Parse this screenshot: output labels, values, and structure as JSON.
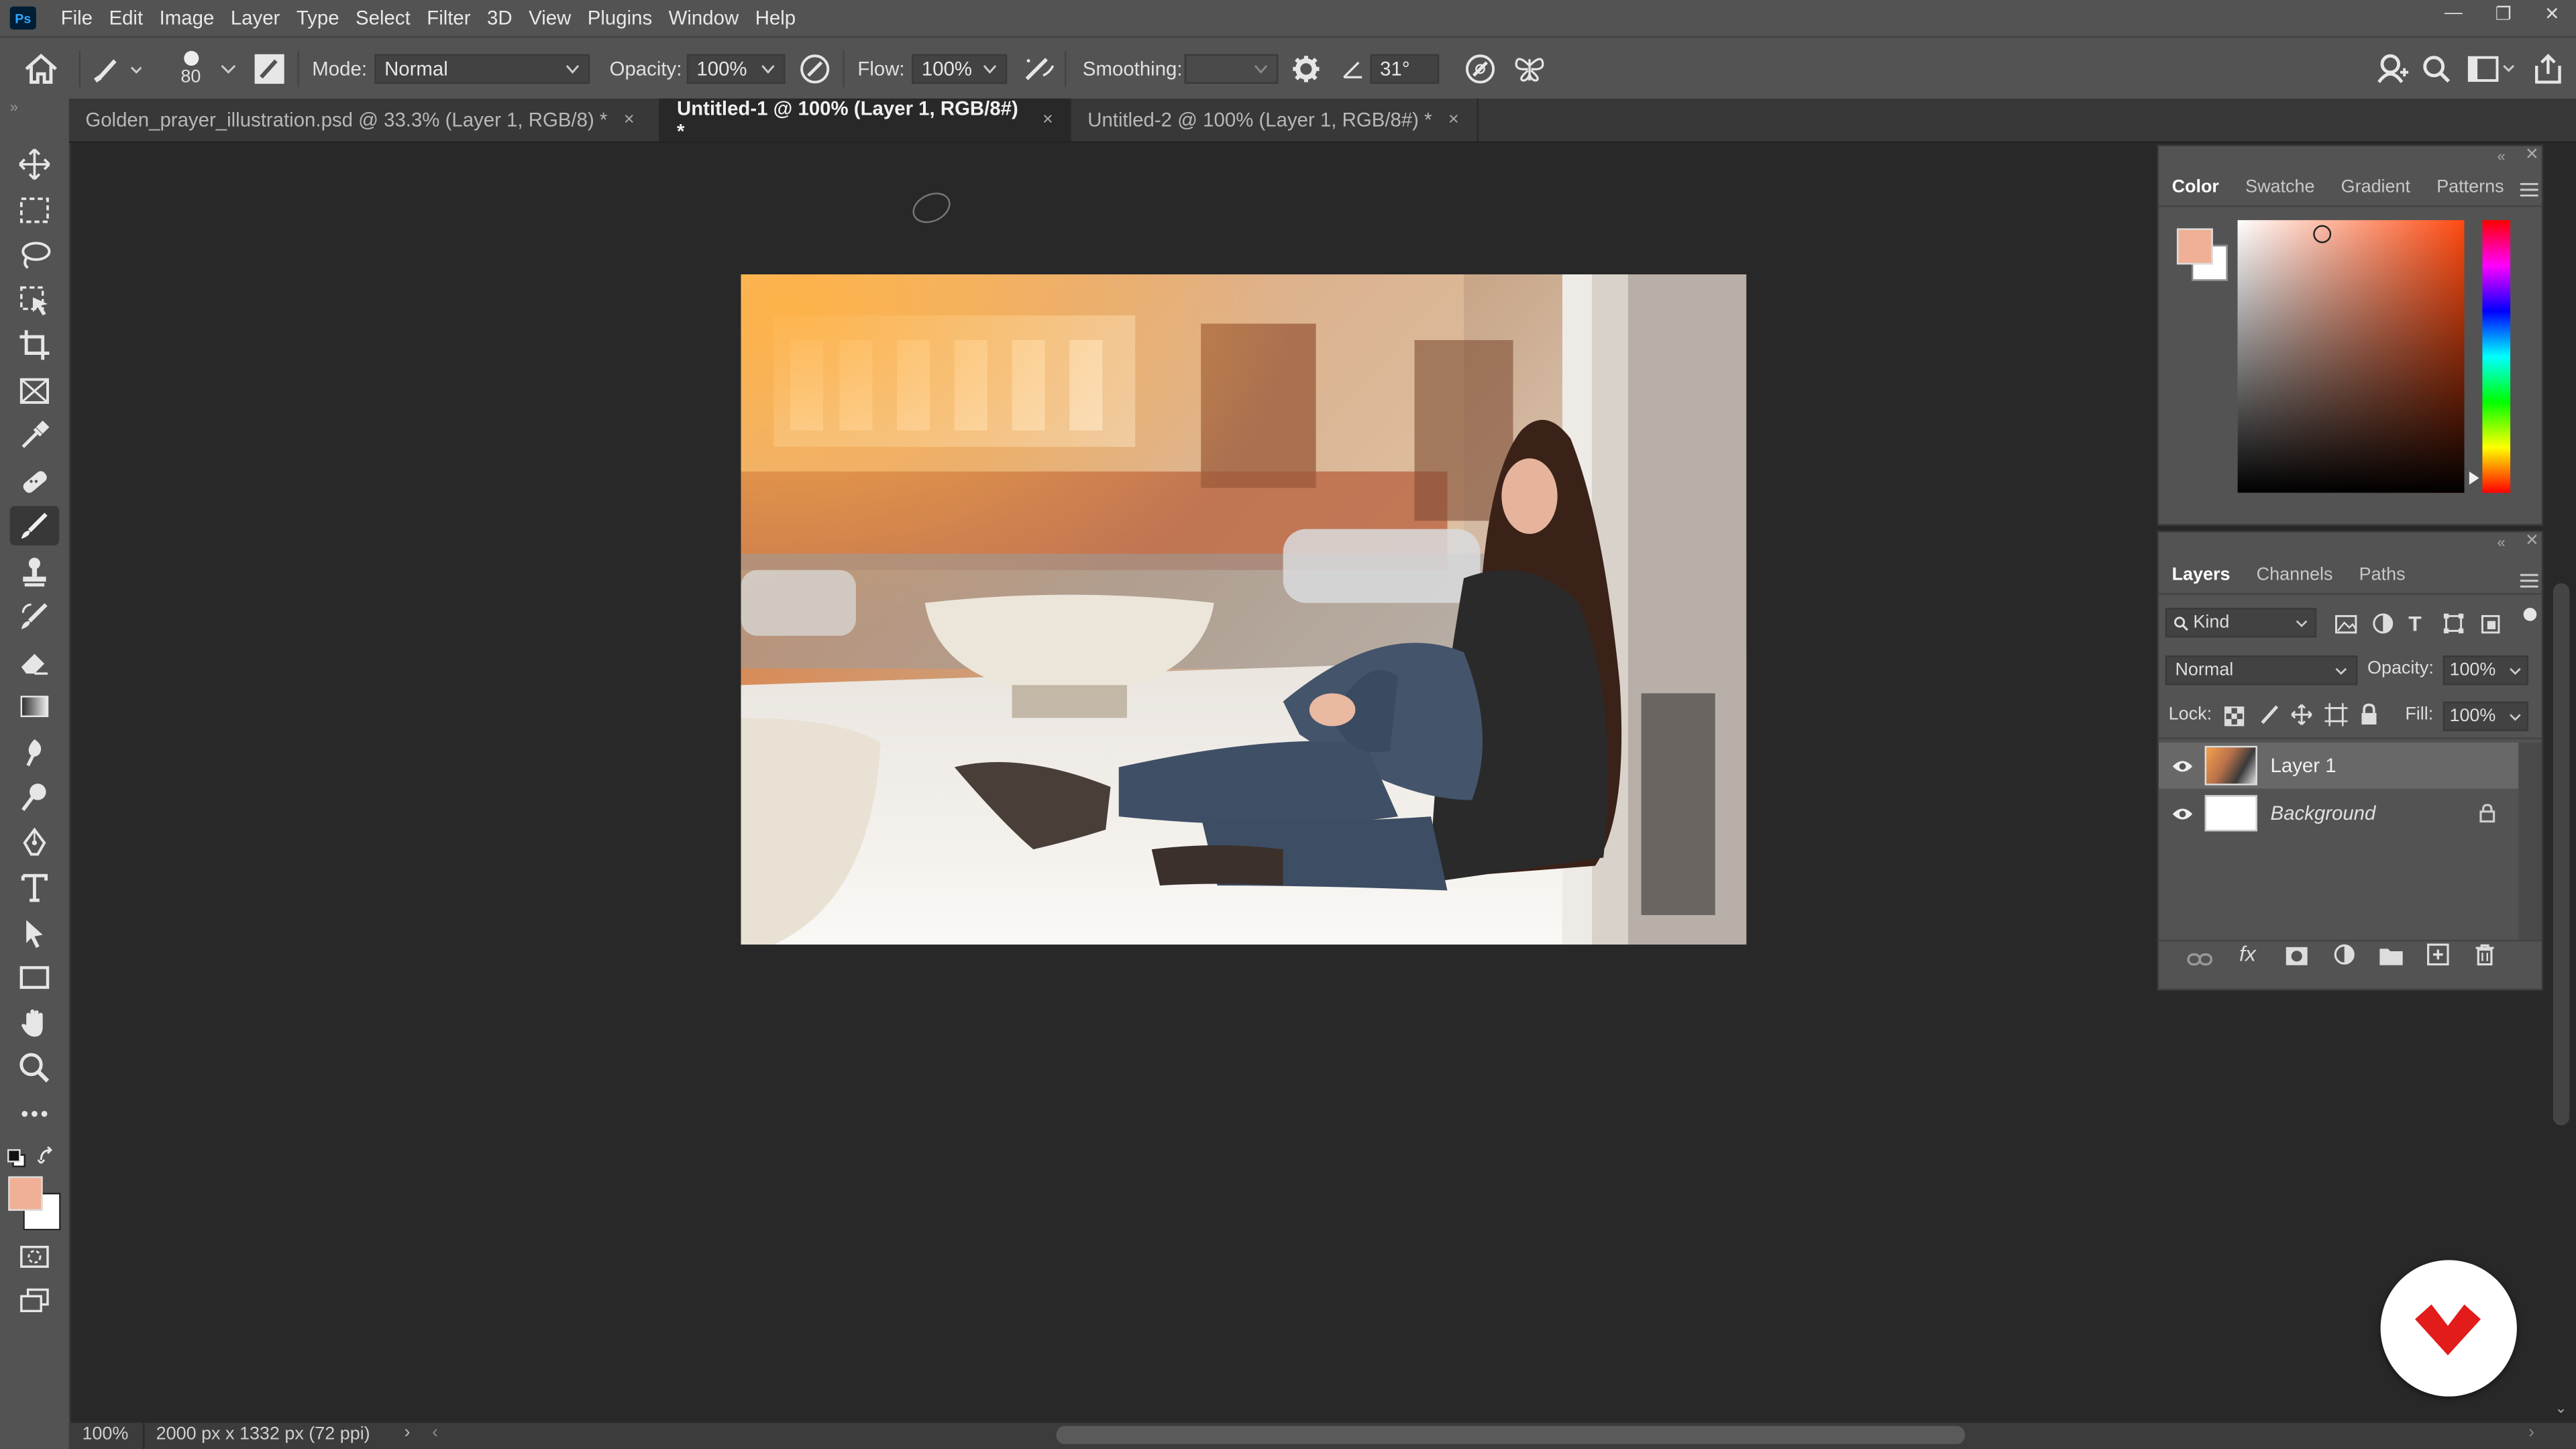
{
  "menu": {
    "app_icon_text": "Ps",
    "items": [
      "File",
      "Edit",
      "Image",
      "Layer",
      "Type",
      "Select",
      "Filter",
      "3D",
      "View",
      "Plugins",
      "Window",
      "Help"
    ]
  },
  "options": {
    "brush_size": "80",
    "mode_label": "Mode:",
    "mode_value": "Normal",
    "opacity_label": "Opacity:",
    "opacity_value": "100%",
    "flow_label": "Flow:",
    "flow_value": "100%",
    "smoothing_label": "Smoothing:",
    "smoothing_value": "",
    "angle_value": "31°"
  },
  "tabs": [
    {
      "label": "Golden_prayer_illustration.psd @ 33.3% (Layer 1, RGB/8) *",
      "close": "×",
      "active": false
    },
    {
      "label": "Untitled-1 @ 100% (Layer 1, RGB/8#) *",
      "close": "×",
      "active": true
    },
    {
      "label": "Untitled-2 @ 100% (Layer 1, RGB/8#) *",
      "close": "×",
      "active": false
    }
  ],
  "color_panel": {
    "tabs": [
      "Color",
      "Swatche",
      "Gradient",
      "Patterns"
    ],
    "foreground_color": "#f0b095",
    "background_color": "#ffffff"
  },
  "layers_panel": {
    "tabs": [
      "Layers",
      "Channels",
      "Paths"
    ],
    "filter_kind": "Kind",
    "blend_mode": "Normal",
    "opacity_label": "Opacity:",
    "opacity_value": "100%",
    "lock_label": "Lock:",
    "fill_label": "Fill:",
    "fill_value": "100%",
    "layers": [
      {
        "name": "Layer 1",
        "visible": true,
        "selected": true,
        "locked": false
      },
      {
        "name": "Background",
        "visible": true,
        "selected": false,
        "locked": true
      }
    ],
    "fx_label": "fx"
  },
  "status": {
    "zoom": "100%",
    "doc_info": "2000 px x 1332 px (72 ppi)"
  },
  "toolbar": {
    "tools": [
      "move-tool",
      "marquee-tool",
      "lasso-tool",
      "object-select-tool",
      "crop-tool",
      "frame-tool",
      "eyedropper-tool",
      "healing-tool",
      "brush-tool",
      "stamp-tool",
      "history-brush-tool",
      "eraser-tool",
      "gradient-tool",
      "blur-tool",
      "dodge-tool",
      "pen-tool",
      "type-tool",
      "path-select-tool",
      "rectangle-tool",
      "hand-tool",
      "zoom-tool",
      "more-tools"
    ]
  }
}
